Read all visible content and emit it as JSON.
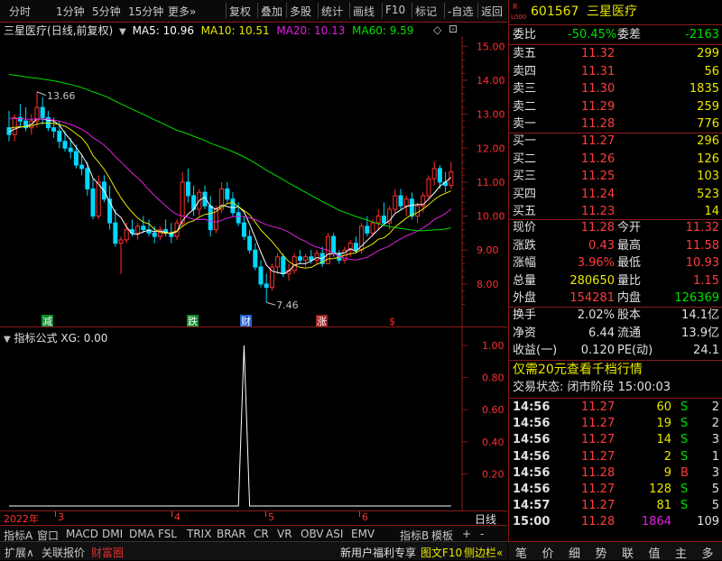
{
  "toolbar": {
    "items": [
      "分时",
      "1分钟",
      "5分钟",
      "15分钟",
      "更多",
      "复权",
      "叠加",
      "多股",
      "统计",
      "画线",
      "F10",
      "标记",
      "-自选",
      "返回"
    ]
  },
  "chart": {
    "stock_name": "三星医疗",
    "mode": "(日线,前复权)",
    "ma5_label": "MA5: 10.96",
    "ma10_label": "MA10: 10.51",
    "ma20_label": "MA20: 10.13",
    "ma60_label": "MA60: 9.59",
    "high_marker": "13.66",
    "low_marker": "7.46",
    "y_ticks": [
      "15.00",
      "14.00",
      "13.00",
      "12.00",
      "11.00",
      "10.00",
      "9.00",
      "8.00"
    ],
    "event_markers": [
      {
        "text": "减",
        "color": "#0a8a2a"
      },
      {
        "text": "跌",
        "color": "#0a8a2a"
      },
      {
        "text": "财",
        "color": "#2060d0"
      },
      {
        "text": "涨",
        "color": "#a02020"
      },
      {
        "text": "$",
        "color": "#ff3030"
      }
    ],
    "colors": {
      "up": "#ff3030",
      "down": "#00d8ff",
      "ma5": "#ffffff",
      "ma10": "#e8e800",
      "ma20": "#e020e0",
      "ma60": "#00e000"
    }
  },
  "chart_data": {
    "type": "candlestick",
    "ma_labels": [
      "MA5",
      "MA10",
      "MA20",
      "MA60"
    ],
    "ylim": [
      7.2,
      15.3
    ],
    "candles": [
      [
        12.6,
        13.1,
        12.2,
        12.4
      ],
      [
        12.4,
        13.0,
        12.2,
        12.9
      ],
      [
        12.9,
        13.3,
        12.6,
        12.8
      ],
      [
        12.8,
        13.2,
        12.5,
        12.6
      ],
      [
        12.6,
        13.0,
        12.4,
        12.8
      ],
      [
        12.8,
        13.66,
        12.6,
        13.2
      ],
      [
        13.2,
        13.5,
        12.7,
        12.9
      ],
      [
        12.9,
        13.1,
        12.5,
        12.6
      ],
      [
        12.6,
        12.9,
        12.3,
        12.5
      ],
      [
        12.5,
        12.8,
        12.0,
        12.2
      ],
      [
        12.2,
        12.5,
        11.9,
        12.0
      ],
      [
        12.0,
        12.3,
        11.7,
        11.9
      ],
      [
        11.9,
        12.1,
        11.4,
        11.5
      ],
      [
        11.5,
        11.8,
        11.2,
        11.4
      ],
      [
        11.4,
        11.6,
        10.6,
        10.8
      ],
      [
        10.8,
        11.1,
        9.9,
        10.0
      ],
      [
        10.0,
        11.2,
        9.9,
        11.0
      ],
      [
        11.0,
        11.2,
        10.4,
        10.5
      ],
      [
        10.5,
        10.9,
        9.6,
        9.8
      ],
      [
        9.8,
        10.2,
        9.1,
        9.2
      ],
      [
        9.2,
        9.4,
        8.3,
        9.3
      ],
      [
        9.3,
        9.8,
        9.2,
        9.6
      ],
      [
        9.6,
        9.9,
        9.4,
        9.5
      ],
      [
        9.5,
        9.8,
        9.3,
        9.7
      ],
      [
        9.7,
        10.0,
        9.5,
        9.6
      ],
      [
        9.6,
        9.9,
        9.4,
        9.5
      ],
      [
        9.5,
        9.7,
        9.2,
        9.4
      ],
      [
        9.4,
        9.7,
        9.3,
        9.6
      ],
      [
        9.6,
        9.9,
        9.4,
        9.5
      ],
      [
        9.5,
        9.8,
        9.2,
        9.4
      ],
      [
        9.4,
        9.9,
        9.3,
        9.8
      ],
      [
        9.8,
        11.3,
        9.7,
        11.0
      ],
      [
        11.0,
        11.4,
        10.4,
        10.6
      ],
      [
        10.6,
        10.9,
        10.0,
        10.2
      ],
      [
        10.2,
        10.8,
        10.0,
        10.7
      ],
      [
        10.7,
        10.9,
        10.2,
        10.3
      ],
      [
        10.3,
        10.6,
        9.4,
        9.6
      ],
      [
        9.6,
        10.3,
        9.5,
        10.2
      ],
      [
        10.2,
        11.0,
        10.1,
        10.8
      ],
      [
        10.8,
        11.0,
        10.4,
        10.5
      ],
      [
        10.5,
        10.7,
        10.0,
        10.1
      ],
      [
        10.1,
        10.4,
        9.7,
        9.8
      ],
      [
        9.8,
        10.0,
        9.3,
        9.4
      ],
      [
        9.4,
        9.6,
        8.9,
        9.0
      ],
      [
        9.0,
        9.2,
        8.4,
        8.5
      ],
      [
        8.5,
        8.7,
        7.9,
        8.0
      ],
      [
        8.0,
        8.3,
        7.46,
        7.9
      ],
      [
        7.9,
        8.6,
        7.8,
        8.5
      ],
      [
        8.5,
        8.9,
        8.3,
        8.8
      ],
      [
        8.8,
        8.9,
        8.2,
        8.3
      ],
      [
        8.3,
        8.6,
        8.1,
        8.4
      ],
      [
        8.4,
        8.9,
        8.3,
        8.8
      ],
      [
        8.8,
        9.0,
        8.6,
        8.7
      ],
      [
        8.7,
        8.9,
        8.5,
        8.8
      ],
      [
        8.8,
        9.0,
        8.6,
        8.7
      ],
      [
        8.7,
        9.0,
        8.6,
        8.9
      ],
      [
        8.9,
        9.1,
        8.5,
        8.6
      ],
      [
        8.6,
        9.5,
        8.6,
        9.4
      ],
      [
        9.4,
        9.5,
        8.8,
        8.9
      ],
      [
        8.9,
        9.0,
        8.6,
        8.7
      ],
      [
        8.7,
        9.1,
        8.6,
        9.0
      ],
      [
        9.0,
        9.3,
        8.8,
        9.2
      ],
      [
        9.2,
        9.4,
        8.9,
        9.0
      ],
      [
        9.0,
        9.8,
        8.9,
        9.7
      ],
      [
        9.7,
        10.0,
        9.4,
        9.5
      ],
      [
        9.5,
        9.9,
        9.4,
        9.8
      ],
      [
        9.8,
        10.2,
        9.6,
        10.0
      ],
      [
        10.0,
        10.4,
        9.7,
        9.8
      ],
      [
        9.8,
        10.3,
        9.6,
        10.2
      ],
      [
        10.2,
        10.8,
        10.1,
        10.6
      ],
      [
        10.6,
        10.8,
        10.2,
        10.3
      ],
      [
        10.3,
        10.6,
        10.0,
        10.5
      ],
      [
        10.5,
        10.7,
        9.9,
        10.0
      ],
      [
        10.0,
        10.4,
        9.8,
        10.3
      ],
      [
        10.3,
        10.7,
        10.1,
        10.6
      ],
      [
        10.6,
        11.2,
        10.5,
        11.1
      ],
      [
        11.1,
        11.6,
        10.9,
        11.4
      ],
      [
        11.4,
        11.5,
        10.8,
        11.0
      ],
      [
        11.0,
        11.3,
        10.7,
        10.9
      ],
      [
        10.9,
        11.6,
        10.8,
        11.3
      ]
    ]
  },
  "x_labels": [
    "2022年",
    "3",
    "4",
    "5",
    "6"
  ],
  "indicator": {
    "title": "指标公式  XG: 0.00",
    "y_ticks": [
      "1.00",
      "0.80",
      "0.60",
      "0.40",
      "0.20"
    ],
    "spike_index": 42
  },
  "indicator_tabs": [
    "指标A",
    "窗口",
    "MACD",
    "DMI",
    "DMA",
    "FSL",
    "TRIX",
    "BRAR",
    "CR",
    "VR",
    "OBV",
    "ASI",
    "EMV",
    "指标B",
    "模板",
    "+",
    "-"
  ],
  "period_label": "日线",
  "bottom_bar": {
    "items": [
      "扩展∧",
      "关联报价",
      "财富圈"
    ],
    "promo": "新用户福利专享",
    "f10": "图文F10",
    "sidebar": "侧边栏«"
  },
  "panel": {
    "code": "601567",
    "name": "三星医疗",
    "weibi_label": "委比",
    "weibi": "-50.45%",
    "weicha_label": "委差",
    "weicha": "-2163",
    "sell": [
      {
        "label": "卖五",
        "price": "11.32",
        "vol": "299"
      },
      {
        "label": "卖四",
        "price": "11.31",
        "vol": "56"
      },
      {
        "label": "卖三",
        "price": "11.30",
        "vol": "1835"
      },
      {
        "label": "卖二",
        "price": "11.29",
        "vol": "259"
      },
      {
        "label": "卖一",
        "price": "11.28",
        "vol": "776"
      }
    ],
    "buy": [
      {
        "label": "买一",
        "price": "11.27",
        "vol": "296"
      },
      {
        "label": "买二",
        "price": "11.26",
        "vol": "126"
      },
      {
        "label": "买三",
        "price": "11.25",
        "vol": "103"
      },
      {
        "label": "买四",
        "price": "11.24",
        "vol": "523"
      },
      {
        "label": "买五",
        "price": "11.23",
        "vol": "14"
      }
    ],
    "stats": [
      {
        "l1": "现价",
        "v1": "11.28",
        "l2": "今开",
        "v2": "11.32",
        "c1": "red",
        "c2": "red"
      },
      {
        "l1": "涨跌",
        "v1": "0.43",
        "l2": "最高",
        "v2": "11.58",
        "c1": "red",
        "c2": "red"
      },
      {
        "l1": "涨幅",
        "v1": "3.96%",
        "l2": "最低",
        "v2": "10.93",
        "c1": "red",
        "c2": "red"
      },
      {
        "l1": "总量",
        "v1": "280650",
        "l2": "量比",
        "v2": "1.15",
        "c1": "yel",
        "c2": "red"
      },
      {
        "l1": "外盘",
        "v1": "154281",
        "l2": "内盘",
        "v2": "126369",
        "c1": "red",
        "c2": "grn"
      }
    ],
    "stats2": [
      {
        "l1": "换手",
        "v1": "2.02%",
        "l2": "股本",
        "v2": "14.1亿"
      },
      {
        "l1": "净资",
        "v1": "6.44",
        "l2": "流通",
        "v2": "13.9亿"
      },
      {
        "l1": "收益(一)",
        "v1": "0.120",
        "l2": "PE(动)",
        "v2": "24.1"
      }
    ],
    "promo": "仅需20元查看千档行情",
    "status": "交易状态: 闭市阶段 15:00:03",
    "ticks": [
      {
        "t": "14:56",
        "p": "11.27",
        "v": "60",
        "f": "S",
        "n": "2"
      },
      {
        "t": "14:56",
        "p": "11.27",
        "v": "19",
        "f": "S",
        "n": "2"
      },
      {
        "t": "14:56",
        "p": "11.27",
        "v": "14",
        "f": "S",
        "n": "3"
      },
      {
        "t": "14:56",
        "p": "11.27",
        "v": "2",
        "f": "S",
        "n": "1"
      },
      {
        "t": "14:56",
        "p": "11.28",
        "v": "9",
        "f": "B",
        "n": "3"
      },
      {
        "t": "14:56",
        "p": "11.27",
        "v": "128",
        "f": "S",
        "n": "5"
      },
      {
        "t": "14:57",
        "p": "11.27",
        "v": "81",
        "f": "S",
        "n": "5"
      },
      {
        "t": "15:00",
        "p": "11.28",
        "v": "1864",
        "f": "",
        "n": "109"
      }
    ],
    "tabs": [
      "笔",
      "价",
      "细",
      "势",
      "联",
      "值",
      "主",
      "多"
    ]
  }
}
